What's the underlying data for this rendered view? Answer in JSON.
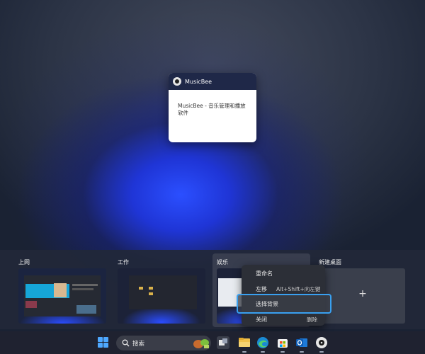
{
  "preview_window": {
    "app_name": "MusicBee",
    "description": "MusicBee - 音乐管理和播放软件"
  },
  "desktops": [
    {
      "label": "上网"
    },
    {
      "label": "工作"
    },
    {
      "label": "娱乐"
    }
  ],
  "new_desktop": {
    "label": "新建桌面",
    "plus": "+"
  },
  "context_menu": {
    "rename": "重命名",
    "move_left": "左移",
    "move_left_shortcut": "Alt+Shift+向左键",
    "choose_background": "选择背景",
    "close": "关闭",
    "delete_shortcut": "删除"
  },
  "taskbar": {
    "search_placeholder": "搜索",
    "icons": [
      "start-icon",
      "search-icon",
      "task-view-icon",
      "file-explorer-icon",
      "edge-icon",
      "store-icon",
      "outlook-icon",
      "musicbee-icon"
    ]
  },
  "colors": {
    "accent": "#39a0f0",
    "start_blue": "#4ea8ff",
    "wallpaper_blue": "#2b4fff"
  }
}
